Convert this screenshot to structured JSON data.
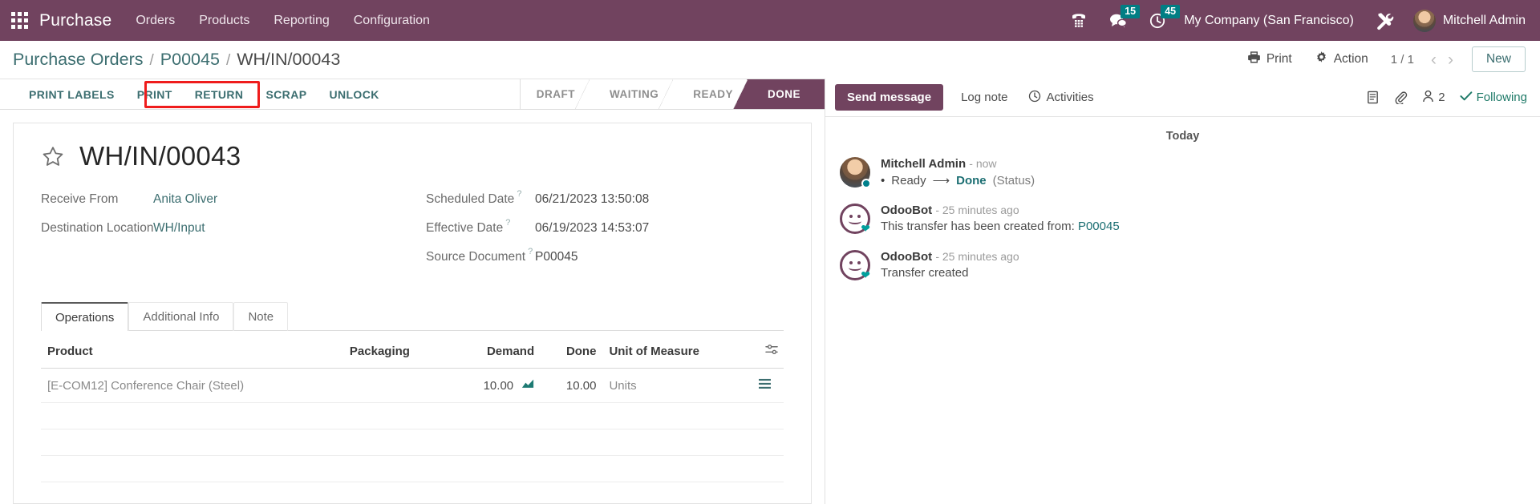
{
  "navbar": {
    "apps_icon": "apps-grid-icon",
    "brand": "Purchase",
    "menu": [
      {
        "label": "Orders"
      },
      {
        "label": "Products"
      },
      {
        "label": "Reporting"
      },
      {
        "label": "Configuration"
      }
    ],
    "dialpad_icon": "dialpad-icon",
    "messages_icon": "messages-icon",
    "messages_count": "15",
    "activities_icon": "clock-icon",
    "activities_count": "45",
    "company": "My Company (San Francisco)",
    "tools_icon": "tools-icon",
    "user": "Mitchell Admin",
    "badge_color": "#017e84",
    "bar_color": "#71435f"
  },
  "control_panel": {
    "breadcrumb": [
      {
        "label": "Purchase Orders",
        "link": true
      },
      {
        "label": "P00045",
        "link": true
      },
      {
        "label": "WH/IN/00043",
        "link": false
      }
    ],
    "separator": "/",
    "print_label": "Print",
    "print_icon": "printer-icon",
    "action_label": "Action",
    "action_icon": "gear-icon",
    "pager": "1 / 1",
    "prev_icon": "chevron-left-icon",
    "next_icon": "chevron-right-icon",
    "new_label": "New"
  },
  "statusbar": {
    "buttons": [
      {
        "label": "PRINT LABELS",
        "highlighted": false
      },
      {
        "label": "PRINT",
        "highlighted": false
      },
      {
        "label": "RETURN",
        "highlighted": true
      },
      {
        "label": "SCRAP",
        "highlighted": true
      },
      {
        "label": "UNLOCK",
        "highlighted": false
      }
    ],
    "highlight_color": "#ef1c1c",
    "states": [
      {
        "label": "DRAFT",
        "active": false
      },
      {
        "label": "WAITING",
        "active": false
      },
      {
        "label": "READY",
        "active": false
      },
      {
        "label": "DONE",
        "active": true
      }
    ]
  },
  "form": {
    "star_icon": "star-icon",
    "title": "WH/IN/00043",
    "left_fields": [
      {
        "label": "Receive From",
        "value": "Anita Oliver",
        "link": true,
        "tip": false
      },
      {
        "label": "Destination Location",
        "value": "WH/Input",
        "link": true,
        "tip": false
      }
    ],
    "right_fields": [
      {
        "label": "Scheduled Date",
        "value": "06/21/2023 13:50:08",
        "link": false,
        "tip": true
      },
      {
        "label": "Effective Date",
        "value": "06/19/2023 14:53:07",
        "link": false,
        "tip": true
      },
      {
        "label": "Source Document",
        "value": "P00045",
        "link": false,
        "tip": true
      }
    ],
    "tip_marker": "?"
  },
  "notebook": {
    "tabs": [
      {
        "label": "Operations",
        "active": true
      },
      {
        "label": "Additional Info",
        "active": false
      },
      {
        "label": "Note",
        "active": false
      }
    ]
  },
  "table": {
    "columns": [
      {
        "label": "Product",
        "align": "left"
      },
      {
        "label": "Packaging",
        "align": "left"
      },
      {
        "label": "Demand",
        "align": "right"
      },
      {
        "label": "Done",
        "align": "right"
      },
      {
        "label": "Unit of Measure",
        "align": "left"
      }
    ],
    "optional_columns_icon": "column-settings-icon",
    "rows": [
      {
        "product": "[E-COM12] Conference Chair (Steel)",
        "packaging": "",
        "demand": "10.00",
        "demand_icon": "forecast-icon",
        "done": "10.00",
        "uom": "Units",
        "row_icon": "detailed-operations-icon"
      }
    ],
    "empty_rows": 3
  },
  "chatter": {
    "send_message_label": "Send message",
    "log_note_label": "Log note",
    "activities_label": "Activities",
    "activities_icon": "clock-icon",
    "attach_doc_icon": "document-icon",
    "attachment_icon": "paperclip-icon",
    "followers_icon": "user-icon",
    "followers_count": "2",
    "following_label": "Following",
    "following_icon": "check-icon",
    "today_label": "Today",
    "messages": [
      {
        "author": "Mitchell Admin",
        "time": "- now",
        "avatar": "photo",
        "online": true,
        "type": "tracking",
        "bullet": "•",
        "old_value": "Ready",
        "arrow": "⟶",
        "new_value": "Done",
        "field": "(Status)"
      },
      {
        "author": "OdooBot",
        "time": "- 25 minutes ago",
        "avatar": "bot",
        "online": false,
        "type": "text",
        "text_prefix": "This transfer has been created from: ",
        "text_link": "P00045"
      },
      {
        "author": "OdooBot",
        "time": "- 25 minutes ago",
        "avatar": "bot",
        "online": false,
        "type": "text",
        "text_prefix": "Transfer created",
        "text_link": ""
      }
    ]
  }
}
